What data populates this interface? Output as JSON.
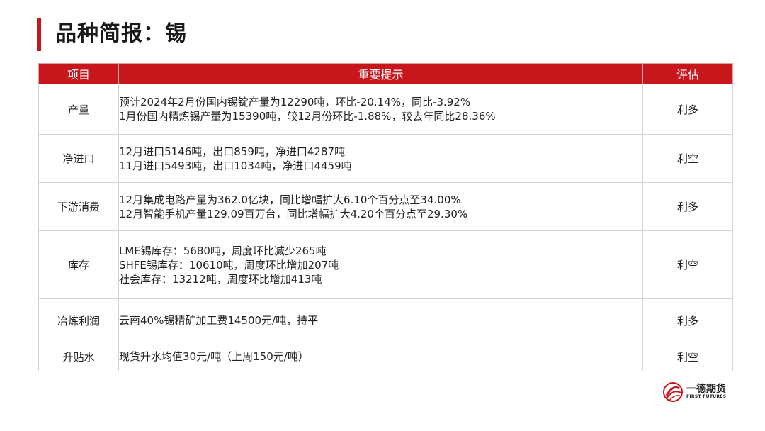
{
  "page": {
    "title": "品种简报：锡"
  },
  "table": {
    "headers": [
      "项目",
      "重要提示",
      "评估"
    ],
    "rows": [
      {
        "item": "产量",
        "hints": [
          "预计2024年2月份国内锡锭产量为12290吨，环比-20.14%，同比-3.92%",
          "1月份国内精炼锡产量为15390吨，较12月份环比-1.88%，较去年同比28.36%"
        ],
        "eval": "利多"
      },
      {
        "item": "净进口",
        "hints": [
          "12月进口5146吨，出口859吨，净进口4287吨",
          "11月进口5493吨，出口1034吨，净进口4459吨"
        ],
        "eval": "利空"
      },
      {
        "item": "下游消费",
        "hints": [
          "12月集成电路产量为362.0亿块，同比增幅扩大6.10个百分点至34.00%",
          "12月智能手机产量129.09百万台，同比增幅扩大4.20个百分点至29.30%"
        ],
        "eval": "利多"
      },
      {
        "item": "库存",
        "hints": [
          "LME锡库存：5680吨，周度环比减少265吨",
          "SHFE锡库存：10610吨，周度环比增加207吨",
          "社会库存：13212吨，周度环比增加413吨"
        ],
        "eval": "利空"
      },
      {
        "item": "冶炼利润",
        "hints": [
          "云南40%锡精矿加工费14500元/吨，持平"
        ],
        "eval": "利多"
      },
      {
        "item": "升贴水",
        "hints": [
          "现货升水均值30元/吨（上周150元/吨）"
        ],
        "eval": "利空"
      }
    ]
  },
  "logo": {
    "name": "一德期货",
    "sub": "FIRST FUTURES",
    "icon": "first-futures-logo-icon"
  },
  "colors": {
    "accent": "#c8161d"
  }
}
